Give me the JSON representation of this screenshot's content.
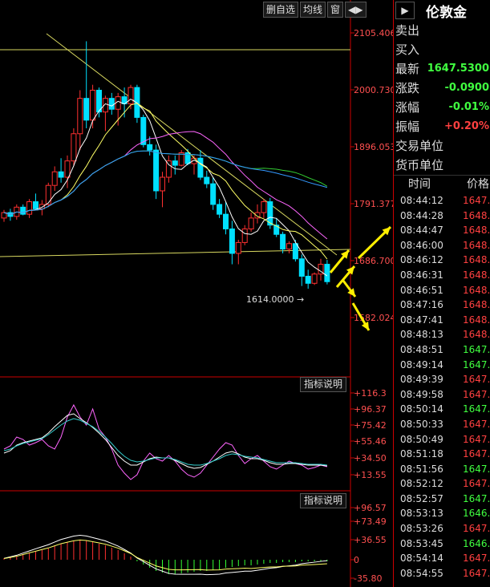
{
  "toolbar": {
    "btn1": "删自选",
    "btn2": "均线",
    "btn3": "窗",
    "btn4": "◀▶"
  },
  "price_axis": [
    "2105.406",
    "2000.730",
    "1896.053",
    "1791.377",
    "1686.700",
    "1582.024"
  ],
  "min_label": "1614.0000",
  "indicator_button_1": "指标说明",
  "indicator_button_2": "指标说明",
  "ind1_axis": [
    "+116.3",
    "+96.37",
    "+75.42",
    "+55.46",
    "+34.50",
    "+13.55"
  ],
  "ind2_axis": [
    "+96.57",
    "+73.49",
    "+36.55",
    "0",
    "-35.80"
  ],
  "panel": {
    "title": "伦敦金",
    "sell_label": "卖出",
    "buy_label": "买入",
    "latest_label": "最新",
    "latest_value": "1647.5300",
    "change_label": "涨跌",
    "change_value": "-0.0900",
    "pct_label": "涨幅",
    "pct_value": "-0.01%",
    "amp_label": "振幅",
    "amp_value": "+0.20%",
    "unit_label": "交易单位",
    "currency_label": "货币单位",
    "time_header": "时间",
    "price_header": "价格",
    "colors": {
      "red": "#ff4040",
      "green": "#40ff40"
    },
    "ticks": [
      {
        "time": "08:44:12",
        "price": "1647.",
        "dir": "red"
      },
      {
        "time": "08:44:28",
        "price": "1648.",
        "dir": "red"
      },
      {
        "time": "08:44:47",
        "price": "1648.",
        "dir": "red"
      },
      {
        "time": "08:46:00",
        "price": "1648.",
        "dir": "red"
      },
      {
        "time": "08:46:12",
        "price": "1648.",
        "dir": "red"
      },
      {
        "time": "08:46:31",
        "price": "1648.",
        "dir": "red"
      },
      {
        "time": "08:46:51",
        "price": "1648.",
        "dir": "red"
      },
      {
        "time": "08:47:16",
        "price": "1648.",
        "dir": "red"
      },
      {
        "time": "08:47:41",
        "price": "1648.",
        "dir": "red"
      },
      {
        "time": "08:48:13",
        "price": "1648.",
        "dir": "red"
      },
      {
        "time": "08:48:51",
        "price": "1647.",
        "dir": "green"
      },
      {
        "time": "08:49:14",
        "price": "1647.",
        "dir": "green"
      },
      {
        "time": "08:49:39",
        "price": "1647.",
        "dir": "red"
      },
      {
        "time": "08:49:58",
        "price": "1647.",
        "dir": "red"
      },
      {
        "time": "08:50:14",
        "price": "1647.",
        "dir": "green"
      },
      {
        "time": "08:50:33",
        "price": "1647.",
        "dir": "red"
      },
      {
        "time": "08:50:49",
        "price": "1647.",
        "dir": "red"
      },
      {
        "time": "08:51:18",
        "price": "1647.",
        "dir": "red"
      },
      {
        "time": "08:51:56",
        "price": "1647.",
        "dir": "green"
      },
      {
        "time": "08:52:12",
        "price": "1647.",
        "dir": "red"
      },
      {
        "time": "08:52:57",
        "price": "1647.",
        "dir": "green"
      },
      {
        "time": "08:53:13",
        "price": "1646.",
        "dir": "green"
      },
      {
        "time": "08:53:26",
        "price": "1647.",
        "dir": "red"
      },
      {
        "time": "08:53:45",
        "price": "1646.",
        "dir": "green"
      },
      {
        "time": "08:54:14",
        "price": "1647.",
        "dir": "red"
      },
      {
        "time": "08:54:55",
        "price": "1647.",
        "dir": "red"
      }
    ]
  },
  "candles": [
    [
      1765,
      1780,
      1758,
      1775
    ],
    [
      1775,
      1782,
      1760,
      1768
    ],
    [
      1768,
      1790,
      1762,
      1785
    ],
    [
      1785,
      1790,
      1770,
      1772
    ],
    [
      1772,
      1800,
      1765,
      1795
    ],
    [
      1795,
      1810,
      1780,
      1782
    ],
    [
      1782,
      1798,
      1770,
      1790
    ],
    [
      1790,
      1830,
      1785,
      1825
    ],
    [
      1825,
      1860,
      1815,
      1850
    ],
    [
      1850,
      1875,
      1830,
      1840
    ],
    [
      1840,
      1880,
      1820,
      1870
    ],
    [
      1870,
      1930,
      1860,
      1920
    ],
    [
      1920,
      2000,
      1890,
      1985
    ],
    [
      1985,
      2090,
      1930,
      1945
    ],
    [
      1945,
      2010,
      1930,
      2000
    ],
    [
      2000,
      2005,
      1950,
      1960
    ],
    [
      1960,
      1990,
      1925,
      1985
    ],
    [
      1985,
      1995,
      1955,
      1965
    ],
    [
      1965,
      1995,
      1935,
      1988
    ],
    [
      1988,
      2005,
      1950,
      1975
    ],
    [
      1975,
      2010,
      1965,
      2005
    ],
    [
      2005,
      2010,
      1940,
      1950
    ],
    [
      1950,
      1955,
      1895,
      1900
    ],
    [
      1900,
      1915,
      1880,
      1890
    ],
    [
      1890,
      1900,
      1800,
      1815
    ],
    [
      1815,
      1850,
      1785,
      1840
    ],
    [
      1840,
      1880,
      1830,
      1870
    ],
    [
      1870,
      1880,
      1845,
      1862
    ],
    [
      1862,
      1890,
      1860,
      1885
    ],
    [
      1885,
      1892,
      1862,
      1865
    ],
    [
      1865,
      1880,
      1845,
      1875
    ],
    [
      1875,
      1890,
      1835,
      1840
    ],
    [
      1840,
      1852,
      1820,
      1828
    ],
    [
      1828,
      1840,
      1780,
      1790
    ],
    [
      1790,
      1800,
      1765,
      1772
    ],
    [
      1772,
      1795,
      1735,
      1745
    ],
    [
      1745,
      1760,
      1680,
      1700
    ],
    [
      1700,
      1725,
      1680,
      1720
    ],
    [
      1720,
      1752,
      1715,
      1745
    ],
    [
      1745,
      1775,
      1740,
      1765
    ],
    [
      1765,
      1790,
      1755,
      1775
    ],
    [
      1775,
      1800,
      1765,
      1795
    ],
    [
      1795,
      1802,
      1745,
      1752
    ],
    [
      1752,
      1765,
      1730,
      1735
    ],
    [
      1735,
      1740,
      1700,
      1708
    ],
    [
      1708,
      1722,
      1700,
      1718
    ],
    [
      1718,
      1725,
      1685,
      1690
    ],
    [
      1690,
      1698,
      1640,
      1658
    ],
    [
      1658,
      1670,
      1635,
      1645
    ],
    [
      1645,
      1665,
      1642,
      1662
    ],
    [
      1662,
      1690,
      1650,
      1680
    ],
    [
      1680,
      1688,
      1643,
      1648
    ]
  ]
}
